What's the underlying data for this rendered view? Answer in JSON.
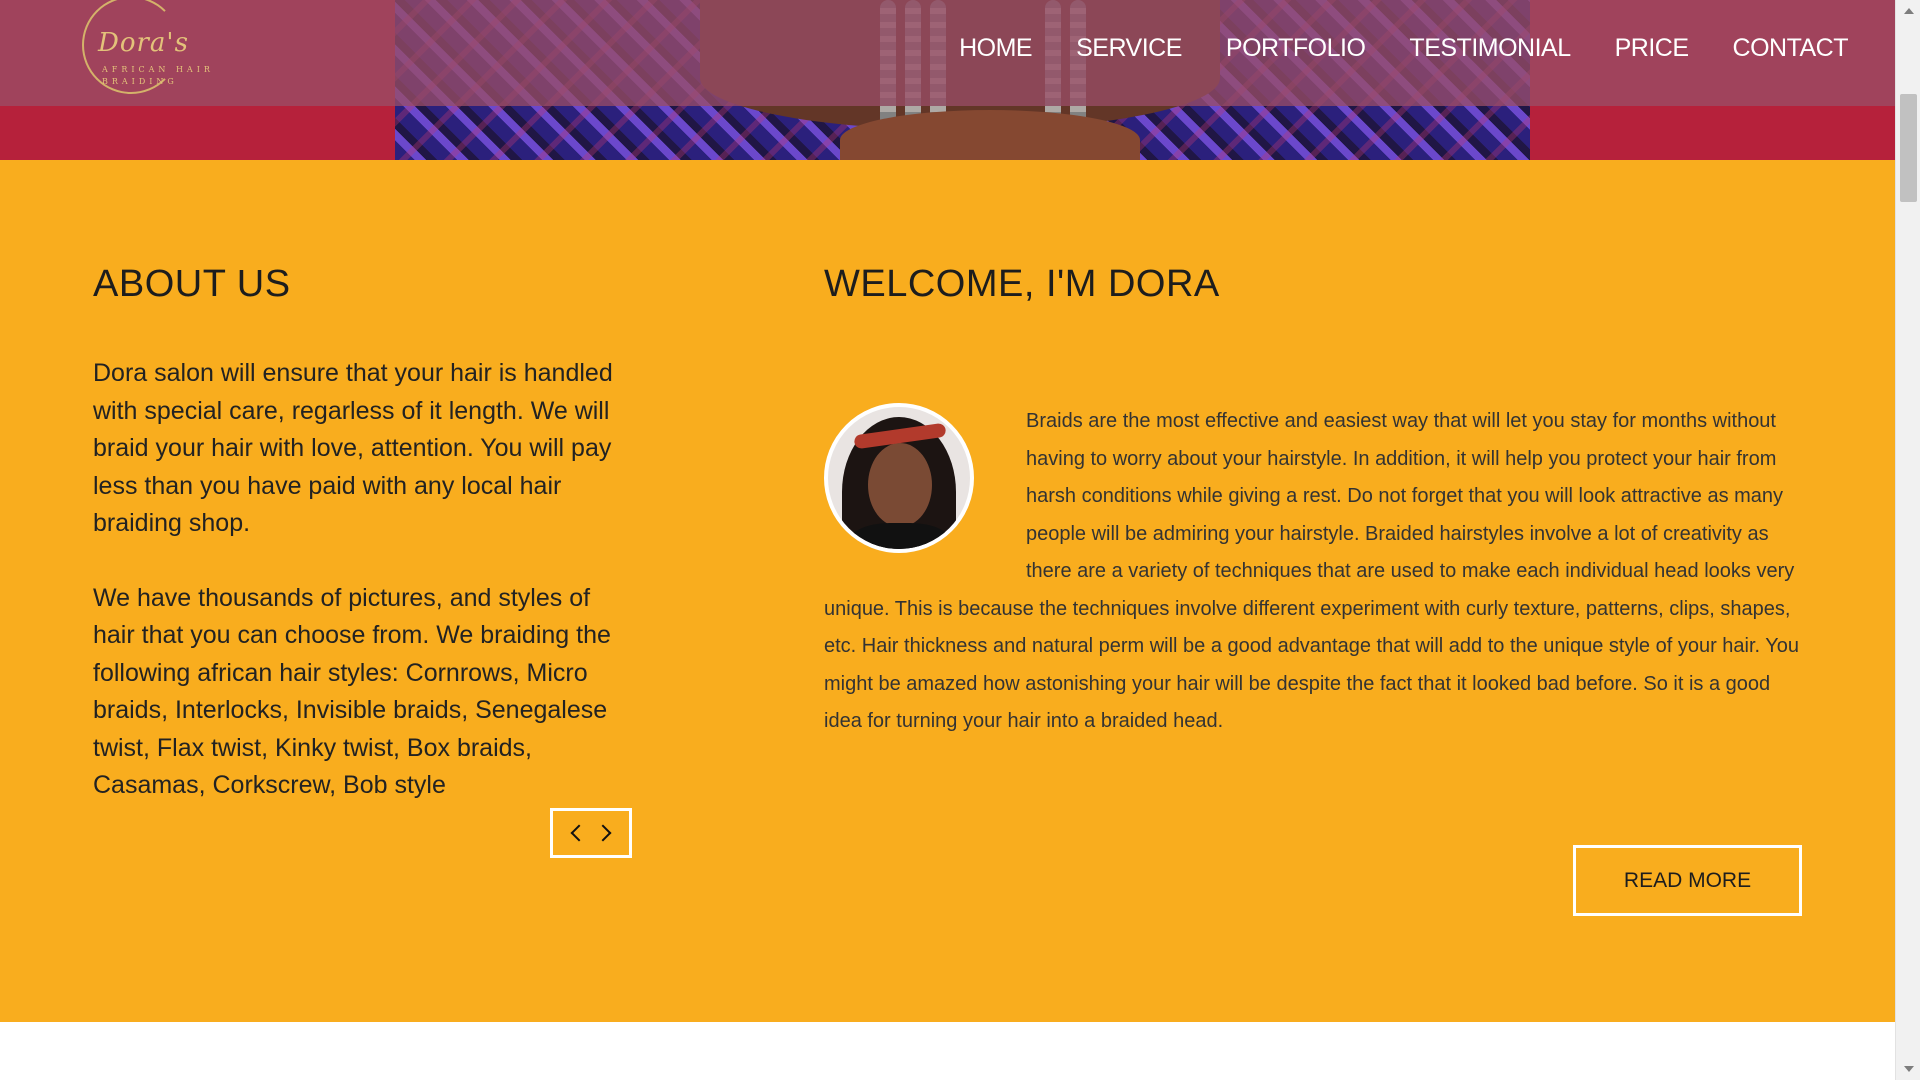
{
  "logo": {
    "script": "Dora's",
    "subtitle": "AFRICAN HAIR BRAIDING",
    "color": "#e3c27a"
  },
  "nav": {
    "items": [
      {
        "label": "HOME"
      },
      {
        "label": "SERVICE"
      },
      {
        "label": "PORTFOLIO"
      },
      {
        "label": "TESTIMONIAL"
      },
      {
        "label": "PRICE"
      },
      {
        "label": "CONTACT"
      }
    ]
  },
  "about": {
    "heading": "ABOUT US",
    "paragraphs": [
      "Dora salon will ensure that your hair is handled with special care, regarless of it length. We will braid your hair with love, attention. You will pay less than you have paid with any local hair braiding shop.",
      "We have thousands of pictures, and styles of hair that you can choose from. We braiding the following african hair styles: Cornrows, Micro braids, Interlocks, Invisible braids, Senegalese twist, Flax twist, Kinky twist, Box braids, Casamas, Corkscrew, Bob style"
    ]
  },
  "welcome": {
    "heading": "WELCOME, I'M DORA",
    "body": "Braids are the most effective and easiest way that will let you stay for months without having to worry about your hairstyle. In addition, it will help you protect your hair from harsh conditions while giving a rest. Do not forget that you will look attractive as many people will be admiring your hairstyle. Braided hairstyles involve a lot of creativity as there are a variety of techniques that are used to make each individual head looks very unique. This is because the techniques involve different experiment with curly texture, patterns, clips, shapes, etc. Hair thickness and natural perm will be a good advantage that will add to the unique style of your hair. You might be amazed how astonishing your hair will be despite the fact that it looked bad before. So it is a good idea for turning your hair into a braided head.",
    "read_more_label": "READ MORE"
  },
  "colors": {
    "section_bg": "#f9ad1e",
    "hero_overlay": "#964b64",
    "hero_red": "#c2243f",
    "button_border": "#ffffff"
  },
  "icons": {
    "prev": "chevron-left-icon",
    "next": "chevron-right-icon"
  }
}
